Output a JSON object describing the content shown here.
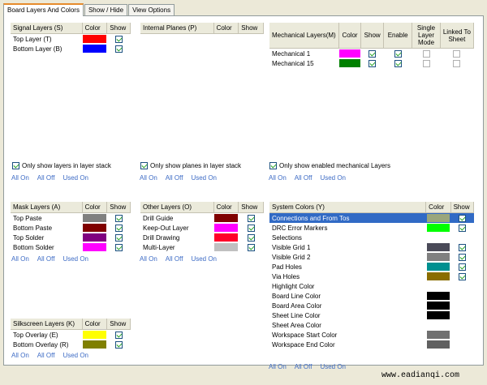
{
  "tabs": [
    "Board Layers And Colors",
    "Show / Hide",
    "View Options"
  ],
  "signal": {
    "headers": [
      "Signal Layers (S)",
      "Color",
      "Show"
    ],
    "rows": [
      {
        "name": "Top Layer (T)",
        "color": "#ff0000",
        "show": true
      },
      {
        "name": "Bottom Layer (B)",
        "color": "#0000ff",
        "show": true
      }
    ],
    "check_label": "Only show layers in layer stack",
    "checked": true
  },
  "planes": {
    "headers": [
      "Internal Planes (P)",
      "Color",
      "Show"
    ],
    "check_label": "Only show planes in layer stack",
    "checked": true
  },
  "mech": {
    "headers": [
      "Mechanical Layers(M)",
      "Color",
      "Show",
      "Enable",
      "Single Layer Mode",
      "Linked To Sheet"
    ],
    "rows": [
      {
        "name": "Mechanical 1",
        "color": "#ff00ff",
        "show": true,
        "enable": true,
        "single": false,
        "linked": false
      },
      {
        "name": "Mechanical 15",
        "color": "#008000",
        "show": true,
        "enable": true,
        "single": false,
        "linked": false
      }
    ],
    "check_label": "Only show enabled mechanical Layers",
    "checked": true
  },
  "mask": {
    "headers": [
      "Mask Layers (A)",
      "Color",
      "Show"
    ],
    "rows": [
      {
        "name": "Top Paste",
        "color": "#808080",
        "show": true
      },
      {
        "name": "Bottom Paste",
        "color": "#800000",
        "show": true
      },
      {
        "name": "Top Solder",
        "color": "#800080",
        "show": true
      },
      {
        "name": "Bottom Solder",
        "color": "#ff00ff",
        "show": true
      }
    ]
  },
  "other": {
    "headers": [
      "Other Layers (O)",
      "Color",
      "Show"
    ],
    "rows": [
      {
        "name": "Drill Guide",
        "color": "#800000",
        "show": true
      },
      {
        "name": "Keep-Out Layer",
        "color": "#ff00ff",
        "show": true
      },
      {
        "name": "Drill Drawing",
        "color": "#ff002a",
        "show": true
      },
      {
        "name": "Multi-Layer",
        "color": "#c0c0c0",
        "show": true
      }
    ]
  },
  "silk": {
    "headers": [
      "Silkscreen Layers (K)",
      "Color",
      "Show"
    ],
    "rows": [
      {
        "name": "Top Overlay (E)",
        "color": "#ffff00",
        "show": true
      },
      {
        "name": "Bottom Overlay (R)",
        "color": "#808000",
        "show": true
      }
    ]
  },
  "system": {
    "headers": [
      "System Colors (Y)",
      "Color",
      "Show"
    ],
    "rows": [
      {
        "name": "Connections and From Tos",
        "color": "#9aa67c",
        "show": true,
        "has_show": true,
        "selected": true
      },
      {
        "name": "DRC Error Markers",
        "color": "#00ff00",
        "show": true,
        "has_show": true,
        "selected": false
      },
      {
        "name": "Selections",
        "color": "",
        "show": false,
        "has_show": false,
        "selected": false
      },
      {
        "name": "Visible Grid 1",
        "color": "#4a4a58",
        "show": true,
        "has_show": true,
        "selected": false
      },
      {
        "name": "Visible Grid 2",
        "color": "#808080",
        "show": true,
        "has_show": true,
        "selected": false
      },
      {
        "name": "Pad Holes",
        "color": "#009090",
        "show": true,
        "has_show": true,
        "selected": false
      },
      {
        "name": "Via Holes",
        "color": "#8a6d00",
        "show": true,
        "has_show": true,
        "selected": false
      },
      {
        "name": "Highlight Color",
        "color": "",
        "show": false,
        "has_show": false,
        "selected": false
      },
      {
        "name": "Board Line Color",
        "color": "#000000",
        "show": false,
        "has_show": false,
        "selected": false
      },
      {
        "name": "Board Area Color",
        "color": "#000000",
        "show": false,
        "has_show": false,
        "selected": false
      },
      {
        "name": "Sheet Line Color",
        "color": "#000000",
        "show": false,
        "has_show": false,
        "selected": false
      },
      {
        "name": "Sheet Area Color",
        "color": "",
        "show": false,
        "has_show": false,
        "selected": false
      },
      {
        "name": "Workspace Start Color",
        "color": "#707070",
        "show": false,
        "has_show": false,
        "selected": false
      },
      {
        "name": "Workspace End Color",
        "color": "#606060",
        "show": false,
        "has_show": false,
        "selected": false
      }
    ]
  },
  "links": [
    "All On",
    "All Off",
    "Used On"
  ],
  "watermark": "www.eadianqi.com"
}
